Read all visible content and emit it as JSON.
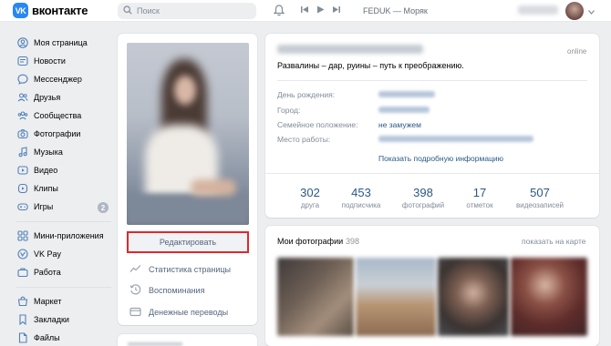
{
  "header": {
    "logo_text": "вконтакте",
    "logo_badge": "VK",
    "search_placeholder": "Поиск",
    "now_playing": "FEDUK — Моряк"
  },
  "sidebar": {
    "items": [
      {
        "label": "Моя страница",
        "icon": "user-circle-icon"
      },
      {
        "label": "Новости",
        "icon": "news-icon"
      },
      {
        "label": "Мессенджер",
        "icon": "message-icon"
      },
      {
        "label": "Друзья",
        "icon": "friends-icon"
      },
      {
        "label": "Сообщества",
        "icon": "groups-icon"
      },
      {
        "label": "Фотографии",
        "icon": "camera-icon"
      },
      {
        "label": "Музыка",
        "icon": "music-icon"
      },
      {
        "label": "Видео",
        "icon": "video-icon"
      },
      {
        "label": "Клипы",
        "icon": "clips-icon"
      },
      {
        "label": "Игры",
        "icon": "games-icon"
      },
      {
        "label": "Мини-приложения",
        "icon": "apps-icon"
      },
      {
        "label": "VK Pay",
        "icon": "vkpay-icon"
      },
      {
        "label": "Работа",
        "icon": "work-icon"
      },
      {
        "label": "Маркет",
        "icon": "market-icon"
      },
      {
        "label": "Закладки",
        "icon": "bookmark-icon"
      },
      {
        "label": "Файлы",
        "icon": "file-icon"
      }
    ],
    "games_badge": "2"
  },
  "profile": {
    "edit_button": "Редактировать",
    "actions": [
      {
        "label": "Статистика страницы",
        "icon": "stats-icon"
      },
      {
        "label": "Воспоминания",
        "icon": "memories-icon"
      },
      {
        "label": "Денежные переводы",
        "icon": "transfer-icon"
      }
    ]
  },
  "info": {
    "online": "online",
    "status": "Развалины – дар, руины – путь к преображению.",
    "rows": [
      {
        "label": "День рождения:"
      },
      {
        "label": "Город:"
      },
      {
        "label": "Семейное положение:",
        "value": "не замужем"
      },
      {
        "label": "Место работы:"
      }
    ],
    "more_link": "Показать подробную информацию",
    "counters": [
      {
        "value": "302",
        "label": "друга"
      },
      {
        "value": "453",
        "label": "подписчика"
      },
      {
        "value": "398",
        "label": "фотографий"
      },
      {
        "value": "17",
        "label": "отметок"
      },
      {
        "value": "507",
        "label": "видеозаписей"
      }
    ]
  },
  "photos": {
    "title": "Мои фотографии",
    "count": "398",
    "map_link": "показать на карте"
  },
  "colors": {
    "accent": "#2787f5",
    "link": "#2a5885",
    "highlight_border": "#e3262b",
    "background": "#edeef0"
  }
}
